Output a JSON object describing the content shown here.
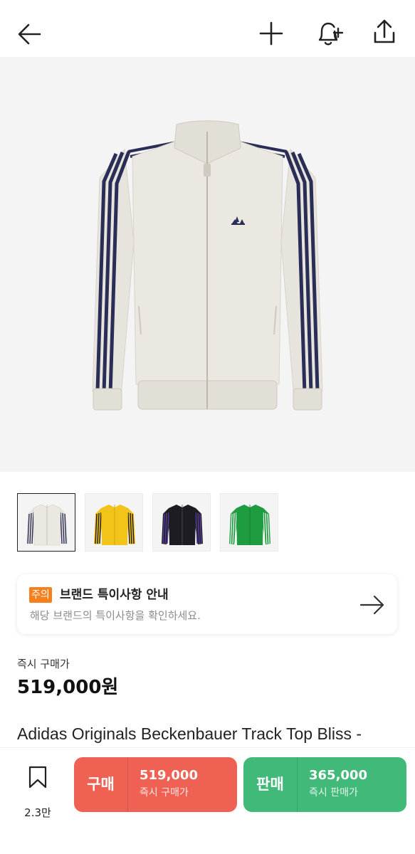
{
  "header": {
    "back_icon": "arrow-left-icon",
    "add_icon": "plus-icon",
    "alert_icon": "bell-plus-icon",
    "share_icon": "share-icon"
  },
  "product_image": {
    "color_main": "#e7e4dd",
    "color_stripe": "#2a2d55"
  },
  "thumbnails": [
    {
      "color": "#e7e4dd",
      "stripe": "#2a2d55",
      "selected": true
    },
    {
      "color": "#f2c318",
      "stripe": "#1a1a1a",
      "selected": false
    },
    {
      "color": "#1c1c22",
      "stripe": "#5b3fa0",
      "selected": false
    },
    {
      "color": "#1f9c3f",
      "stripe": "#ffffff",
      "selected": false
    }
  ],
  "notice": {
    "badge": "주의",
    "title": "브랜드 특이사항 안내",
    "description": "해당 브랜드의 특이사항을 확인하세요."
  },
  "price": {
    "label": "즉시 구매가",
    "value": "519,000원"
  },
  "product_name": "Adidas Originals Beckenbauer Track Top Bliss -",
  "bottom": {
    "wish_count": "2.3만",
    "buy": {
      "label": "구매",
      "price": "519,000",
      "sub": "즉시 구매가",
      "color": "#ef6253"
    },
    "sell": {
      "label": "판매",
      "price": "365,000",
      "sub": "즉시 판매가",
      "color": "#41b979"
    }
  }
}
